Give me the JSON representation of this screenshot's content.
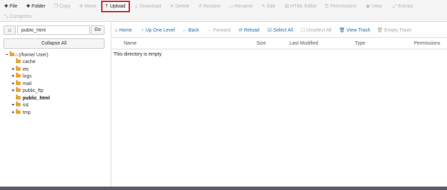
{
  "toolbar": {
    "buttons": [
      {
        "label": "File",
        "icon": "plus-icon",
        "glyph": "✚",
        "active": true
      },
      {
        "label": "Folder",
        "icon": "plus-icon",
        "glyph": "✚",
        "active": true
      },
      {
        "label": "Copy",
        "icon": "copy-icon",
        "glyph": "❐",
        "active": false
      },
      {
        "label": "Move",
        "icon": "move-icon",
        "glyph": "✣",
        "active": false
      },
      {
        "label": "Upload",
        "icon": "upload-icon",
        "glyph": "⤒",
        "active": true
      },
      {
        "label": "Download",
        "icon": "download-icon",
        "glyph": "⤓",
        "active": false
      },
      {
        "label": "Delete",
        "icon": "delete-icon",
        "glyph": "✕",
        "active": false
      },
      {
        "label": "Restore",
        "icon": "restore-icon",
        "glyph": "↺",
        "active": false
      },
      {
        "label": "Rename",
        "icon": "rename-icon",
        "glyph": "▭",
        "active": false
      },
      {
        "label": "Edit",
        "icon": "edit-icon",
        "glyph": "✎",
        "active": false
      },
      {
        "label": "HTML Editor",
        "icon": "html-editor-icon",
        "glyph": "▤",
        "active": false
      },
      {
        "label": "Permissions",
        "icon": "key-icon",
        "glyph": "⚿",
        "active": false
      },
      {
        "label": "View",
        "icon": "eye-icon",
        "glyph": "◉",
        "active": false
      },
      {
        "label": "Extract",
        "icon": "extract-icon",
        "glyph": "⤢",
        "active": false
      },
      {
        "label": "Compress",
        "icon": "compress-icon",
        "glyph": "⤡",
        "active": false
      }
    ]
  },
  "sidebar": {
    "home_glyph": "⌂",
    "path_value": "public_html",
    "go_label": "Go",
    "collapse_label": "Collapse All",
    "tree": [
      {
        "label": "(/home/ User)",
        "expander": "−",
        "folder": "home",
        "bold": false
      },
      {
        "label": "cache",
        "expander": "",
        "folder": "folder",
        "bold": false
      },
      {
        "label": "etc",
        "expander": "+",
        "folder": "folder",
        "bold": false
      },
      {
        "label": "logs",
        "expander": "+",
        "folder": "folder",
        "bold": false
      },
      {
        "label": "mail",
        "expander": "+",
        "folder": "folder",
        "bold": false
      },
      {
        "label": "public_ftp",
        "expander": "+",
        "folder": "folder",
        "bold": false
      },
      {
        "label": "public_html",
        "expander": "",
        "folder": "folder",
        "bold": true
      },
      {
        "label": "ssl",
        "expander": "+",
        "folder": "folder",
        "bold": false
      },
      {
        "label": "tmp",
        "expander": "+",
        "folder": "folder",
        "bold": false
      }
    ]
  },
  "main_toolbar": {
    "buttons": [
      {
        "label": "Home",
        "glyph": "⌂",
        "icon": "home-icon",
        "disabled": false
      },
      {
        "label": "Up One Level",
        "glyph": "↑",
        "icon": "up-arrow-icon",
        "disabled": false
      },
      {
        "label": "Back",
        "glyph": "←",
        "icon": "back-arrow-icon",
        "disabled": false
      },
      {
        "label": "Forward",
        "glyph": "→",
        "icon": "forward-arrow-icon",
        "disabled": true
      },
      {
        "label": "Reload",
        "glyph": "⟳",
        "icon": "reload-icon",
        "disabled": false
      },
      {
        "label": "Select All",
        "glyph": "☑",
        "icon": "select-all-icon",
        "disabled": false
      },
      {
        "label": "Unselect All",
        "glyph": "☐",
        "icon": "unselect-all-icon",
        "disabled": true
      },
      {
        "label": "View Trash",
        "glyph": "🗑",
        "icon": "trash-icon",
        "disabled": false
      },
      {
        "label": "Empty Trash",
        "glyph": "🗑",
        "icon": "empty-trash-icon",
        "disabled": true
      }
    ]
  },
  "table": {
    "headers": [
      "Name",
      "Size",
      "Last Modified",
      "Type",
      "Permissions"
    ],
    "empty_message": "This directory is empty"
  },
  "colors": {
    "accent": "#1b6fab",
    "highlight": "#d9262b",
    "folder": "#e8a534"
  }
}
